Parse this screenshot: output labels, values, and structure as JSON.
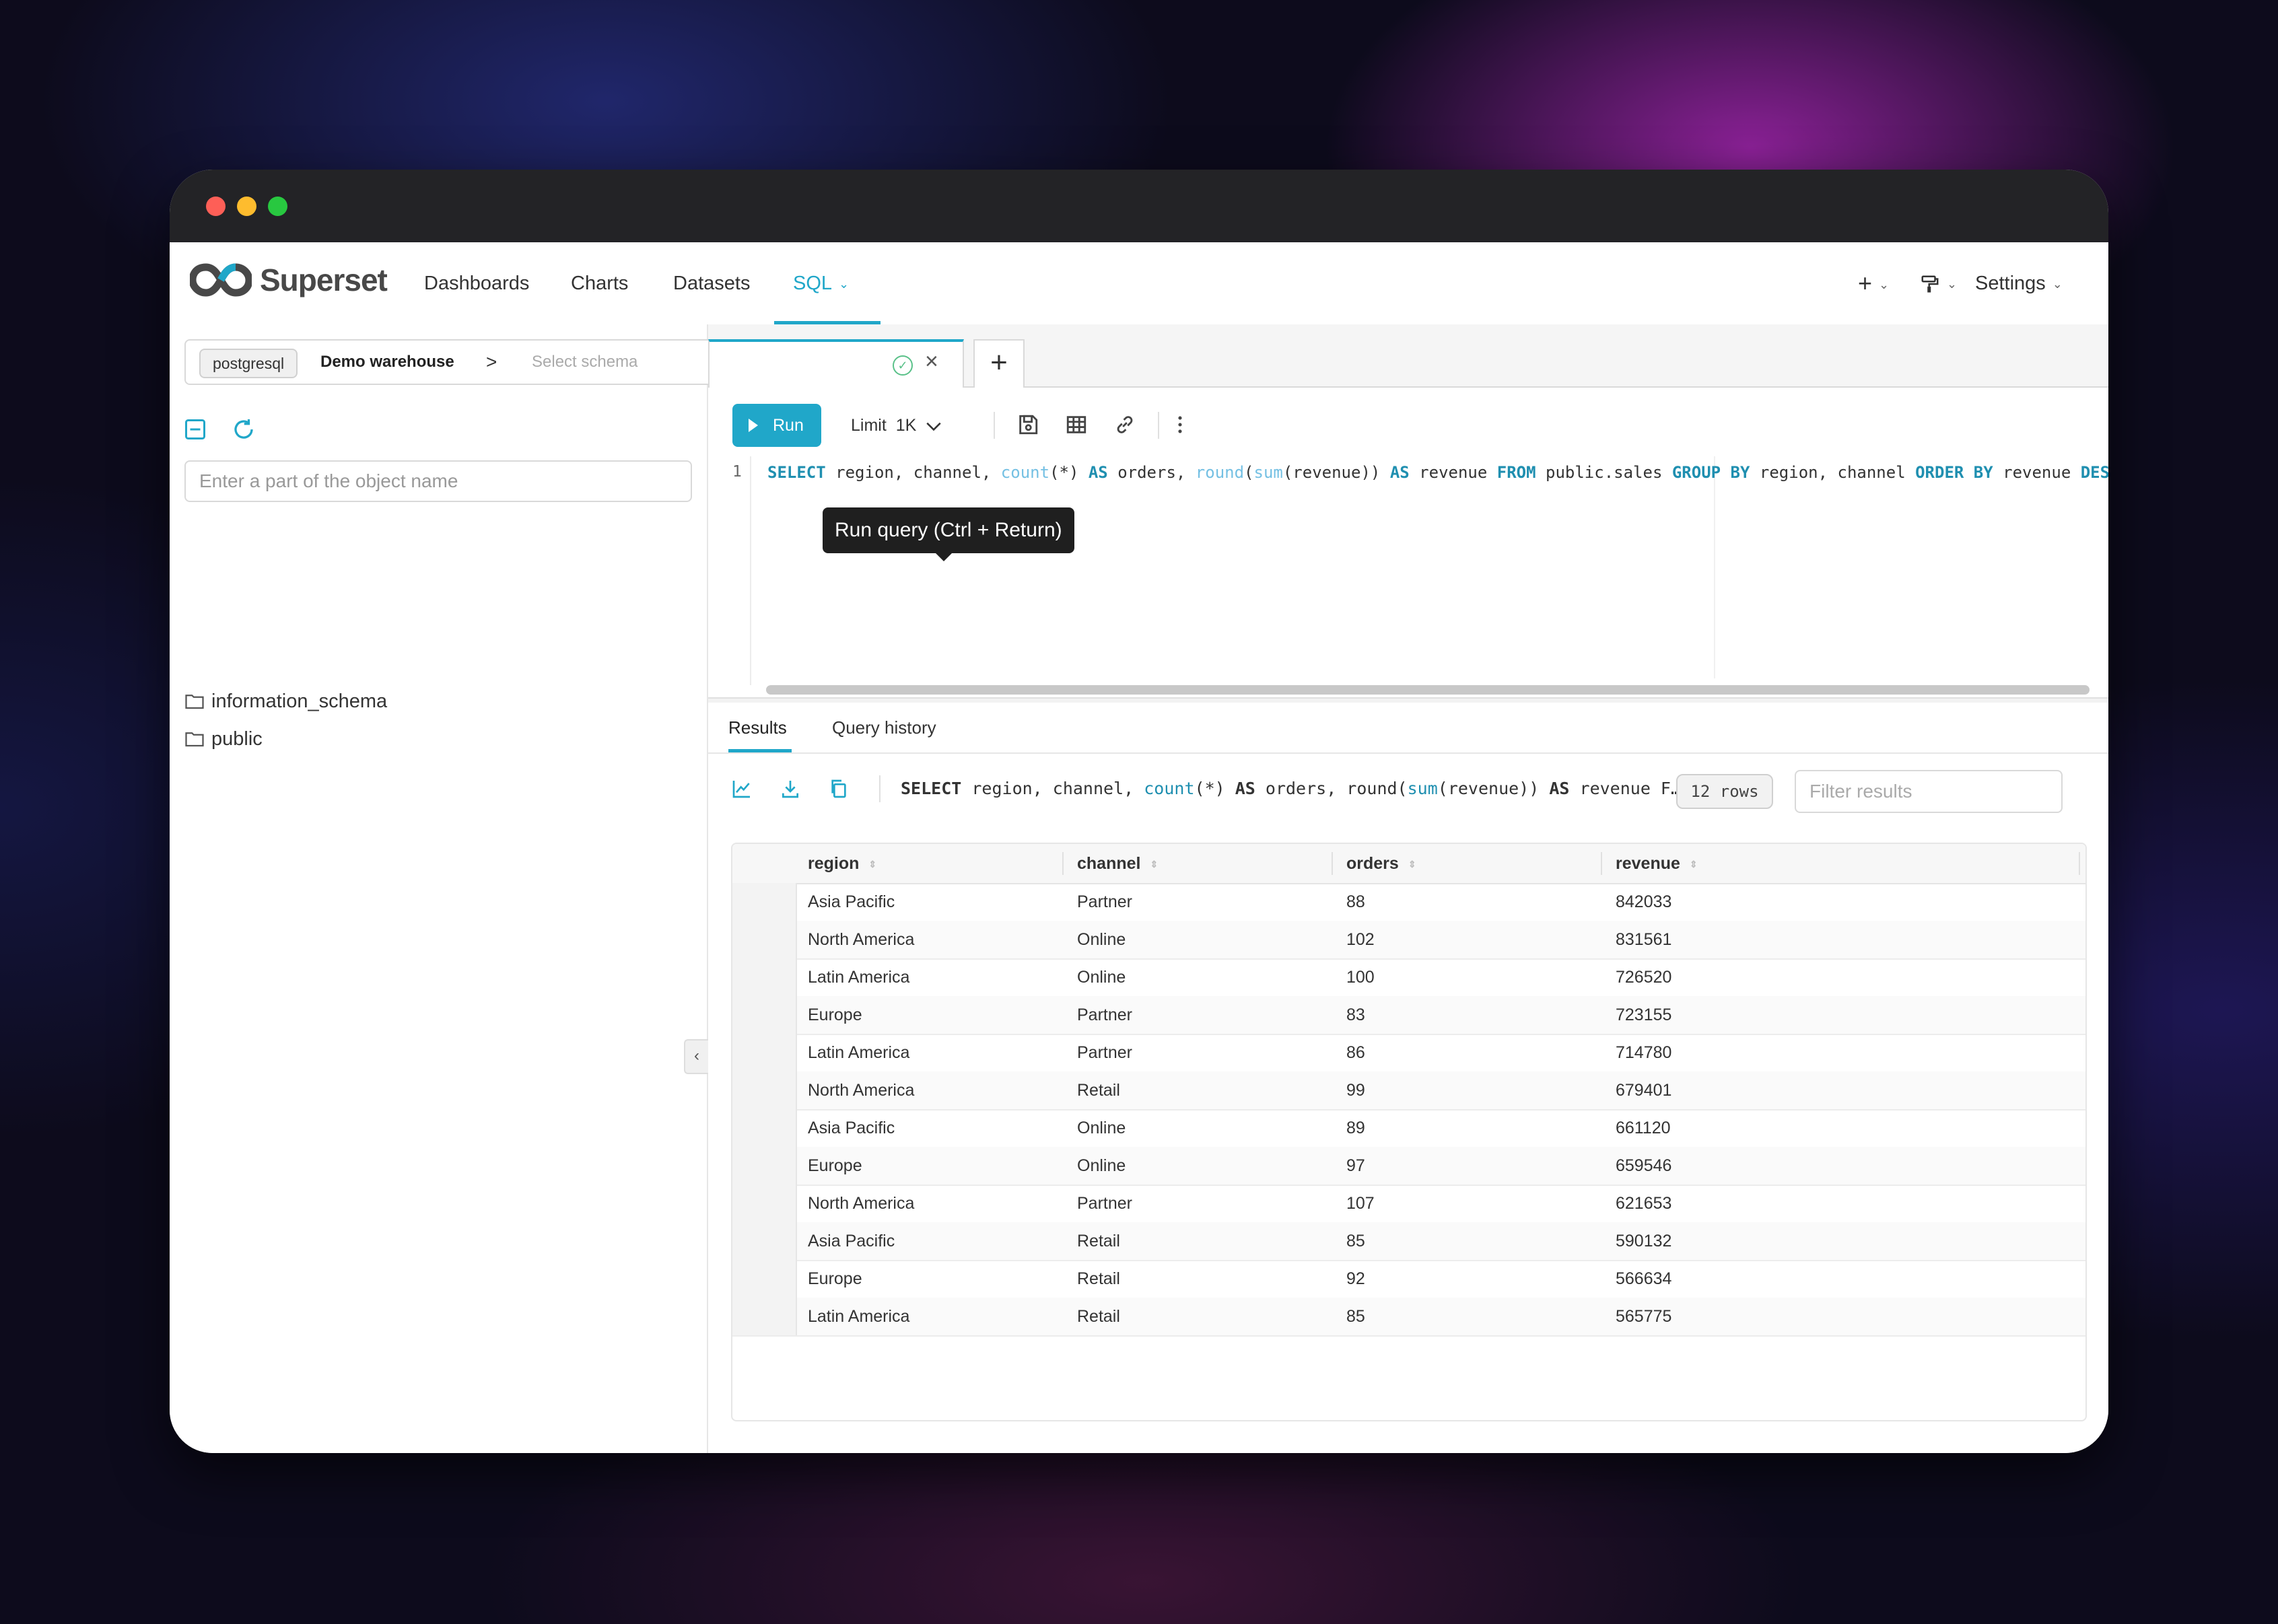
{
  "app": {
    "name": "Superset"
  },
  "nav": {
    "items": [
      "Dashboards",
      "Charts",
      "Datasets"
    ],
    "active": "SQL",
    "plus": "+",
    "settings": "Settings"
  },
  "left": {
    "db_engine": "postgresql",
    "db_name": "Demo warehouse",
    "schema_placeholder": "Select schema",
    "search_placeholder": "Enter a part of the object name",
    "schemas": [
      "information_schema",
      "public"
    ]
  },
  "tooltip": "Run query (Ctrl + Return)",
  "toolbar": {
    "run_label": "Run",
    "limit_label": "Limit",
    "limit_value": "1K"
  },
  "editor": {
    "line_number": "1",
    "tokens": [
      {
        "t": "SELECT",
        "c": "kw"
      },
      {
        "t": " region, channel, ",
        "c": ""
      },
      {
        "t": "count",
        "c": "fn"
      },
      {
        "t": "(*) ",
        "c": ""
      },
      {
        "t": "AS",
        "c": "kw"
      },
      {
        "t": " orders, ",
        "c": ""
      },
      {
        "t": "round",
        "c": "fn"
      },
      {
        "t": "(",
        "c": ""
      },
      {
        "t": "sum",
        "c": "fn"
      },
      {
        "t": "(revenue)) ",
        "c": ""
      },
      {
        "t": "AS",
        "c": "kw"
      },
      {
        "t": " revenue ",
        "c": ""
      },
      {
        "t": "FROM",
        "c": "kw"
      },
      {
        "t": " public.sales ",
        "c": ""
      },
      {
        "t": "GROUP BY",
        "c": "kw"
      },
      {
        "t": " region, channel ",
        "c": ""
      },
      {
        "t": "ORDER BY",
        "c": "kw"
      },
      {
        "t": " revenue ",
        "c": ""
      },
      {
        "t": "DES",
        "c": "kw"
      }
    ]
  },
  "results": {
    "tab_results": "Results",
    "tab_history": "Query history",
    "sql_preview_tokens": [
      {
        "t": "SELECT",
        "c": "b"
      },
      {
        "t": " region, channel, ",
        "c": ""
      },
      {
        "t": "count",
        "c": "fn"
      },
      {
        "t": "(*) ",
        "c": ""
      },
      {
        "t": "AS",
        "c": "b"
      },
      {
        "t": " orders, round(",
        "c": ""
      },
      {
        "t": "sum",
        "c": "fn"
      },
      {
        "t": "(revenue)) ",
        "c": ""
      },
      {
        "t": "AS",
        "c": "b"
      },
      {
        "t": " revenue F…",
        "c": ""
      }
    ],
    "row_count": "12 rows",
    "filter_placeholder": "Filter results",
    "columns": [
      "region",
      "channel",
      "orders",
      "revenue"
    ],
    "rows": [
      [
        "Asia Pacific",
        "Partner",
        "88",
        "842033"
      ],
      [
        "North America",
        "Online",
        "102",
        "831561"
      ],
      [
        "Latin America",
        "Online",
        "100",
        "726520"
      ],
      [
        "Europe",
        "Partner",
        "83",
        "723155"
      ],
      [
        "Latin America",
        "Partner",
        "86",
        "714780"
      ],
      [
        "North America",
        "Retail",
        "99",
        "679401"
      ],
      [
        "Asia Pacific",
        "Online",
        "89",
        "661120"
      ],
      [
        "Europe",
        "Online",
        "97",
        "659546"
      ],
      [
        "North America",
        "Partner",
        "107",
        "621653"
      ],
      [
        "Asia Pacific",
        "Retail",
        "85",
        "590132"
      ],
      [
        "Europe",
        "Retail",
        "92",
        "566634"
      ],
      [
        "Latin America",
        "Retail",
        "85",
        "565775"
      ]
    ]
  },
  "colors": {
    "accent": "#20a7c9",
    "titlebar": "#232326"
  }
}
